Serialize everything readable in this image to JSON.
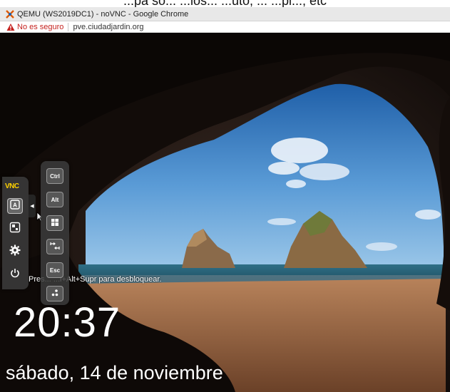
{
  "caption": {
    "text": "...pa so... ...los... ...uto, ... ...pl..., etc"
  },
  "browser": {
    "window_title": "QEMU (WS2019DC1) - noVNC - Google Chrome",
    "security_label": "No es seguro",
    "url": "pve.ciudadjardin.org"
  },
  "novnc": {
    "logo": "VNC",
    "sidebar_buttons": [
      "keyboard-icon",
      "extra-keys-icon",
      "settings-icon",
      "power-icon"
    ],
    "extra_keys": {
      "ctrl": "Ctrl",
      "alt": "Alt",
      "windows": "windows-icon",
      "tab": "tab-icon",
      "esc": "Esc",
      "ctrl_alt_del": "ctrl-alt-del-icon"
    }
  },
  "lockscreen": {
    "unlock_hint": "Pres... ...l+Alt+Supr para desbloquear.",
    "time": "20:37",
    "date": "sábado, 14 de noviembre"
  },
  "colors": {
    "accent_vnc": "#ffd200",
    "warning": "#c5221f"
  }
}
